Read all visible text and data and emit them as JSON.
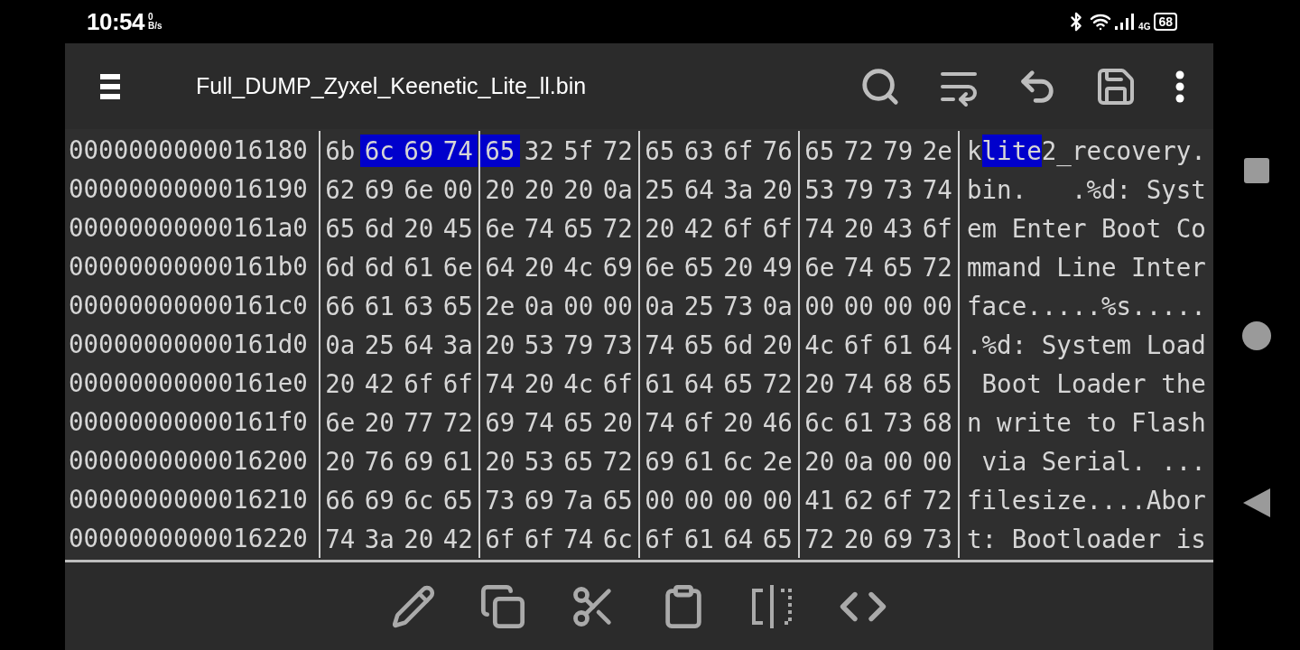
{
  "status_bar": {
    "time": "10:54",
    "net_speed_value": "0",
    "net_speed_unit": "B/s",
    "network_type": "4G",
    "battery": "68"
  },
  "toolbar": {
    "title": "Full_DUMP_Zyxel_Keenetic_Lite_ll.bin"
  },
  "hex_rows": [
    {
      "address": "0000000000016180",
      "bytes": [
        {
          "hex": "6b",
          "selected": false
        },
        {
          "hex": "6c",
          "selected": true
        },
        {
          "hex": "69",
          "selected": true
        },
        {
          "hex": "74",
          "selected": true
        },
        {
          "hex": "65",
          "selected": true
        },
        {
          "hex": "32",
          "selected": false
        },
        {
          "hex": "5f",
          "selected": false
        },
        {
          "hex": "72",
          "selected": false
        },
        {
          "hex": "65",
          "selected": false
        },
        {
          "hex": "63",
          "selected": false
        },
        {
          "hex": "6f",
          "selected": false
        },
        {
          "hex": "76",
          "selected": false
        },
        {
          "hex": "65",
          "selected": false
        },
        {
          "hex": "72",
          "selected": false
        },
        {
          "hex": "79",
          "selected": false
        },
        {
          "hex": "2e",
          "selected": false
        }
      ],
      "ascii": [
        {
          "text": "k",
          "selected": false
        },
        {
          "text": "lite",
          "selected": true
        },
        {
          "text": "2_recovery.",
          "selected": false
        }
      ]
    },
    {
      "address": "0000000000016190",
      "bytes": [
        {
          "hex": "62",
          "selected": false
        },
        {
          "hex": "69",
          "selected": false
        },
        {
          "hex": "6e",
          "selected": false
        },
        {
          "hex": "00",
          "selected": false
        },
        {
          "hex": "20",
          "selected": false
        },
        {
          "hex": "20",
          "selected": false
        },
        {
          "hex": "20",
          "selected": false
        },
        {
          "hex": "0a",
          "selected": false
        },
        {
          "hex": "25",
          "selected": false
        },
        {
          "hex": "64",
          "selected": false
        },
        {
          "hex": "3a",
          "selected": false
        },
        {
          "hex": "20",
          "selected": false
        },
        {
          "hex": "53",
          "selected": false
        },
        {
          "hex": "79",
          "selected": false
        },
        {
          "hex": "73",
          "selected": false
        },
        {
          "hex": "74",
          "selected": false
        }
      ],
      "ascii": [
        {
          "text": "bin.   .%d: Syst",
          "selected": false
        }
      ]
    },
    {
      "address": "00000000000161a0",
      "bytes": [
        {
          "hex": "65",
          "selected": false
        },
        {
          "hex": "6d",
          "selected": false
        },
        {
          "hex": "20",
          "selected": false
        },
        {
          "hex": "45",
          "selected": false
        },
        {
          "hex": "6e",
          "selected": false
        },
        {
          "hex": "74",
          "selected": false
        },
        {
          "hex": "65",
          "selected": false
        },
        {
          "hex": "72",
          "selected": false
        },
        {
          "hex": "20",
          "selected": false
        },
        {
          "hex": "42",
          "selected": false
        },
        {
          "hex": "6f",
          "selected": false
        },
        {
          "hex": "6f",
          "selected": false
        },
        {
          "hex": "74",
          "selected": false
        },
        {
          "hex": "20",
          "selected": false
        },
        {
          "hex": "43",
          "selected": false
        },
        {
          "hex": "6f",
          "selected": false
        }
      ],
      "ascii": [
        {
          "text": "em Enter Boot Co",
          "selected": false
        }
      ]
    },
    {
      "address": "00000000000161b0",
      "bytes": [
        {
          "hex": "6d",
          "selected": false
        },
        {
          "hex": "6d",
          "selected": false
        },
        {
          "hex": "61",
          "selected": false
        },
        {
          "hex": "6e",
          "selected": false
        },
        {
          "hex": "64",
          "selected": false
        },
        {
          "hex": "20",
          "selected": false
        },
        {
          "hex": "4c",
          "selected": false
        },
        {
          "hex": "69",
          "selected": false
        },
        {
          "hex": "6e",
          "selected": false
        },
        {
          "hex": "65",
          "selected": false
        },
        {
          "hex": "20",
          "selected": false
        },
        {
          "hex": "49",
          "selected": false
        },
        {
          "hex": "6e",
          "selected": false
        },
        {
          "hex": "74",
          "selected": false
        },
        {
          "hex": "65",
          "selected": false
        },
        {
          "hex": "72",
          "selected": false
        }
      ],
      "ascii": [
        {
          "text": "mmand Line Inter",
          "selected": false
        }
      ]
    },
    {
      "address": "00000000000161c0",
      "bytes": [
        {
          "hex": "66",
          "selected": false
        },
        {
          "hex": "61",
          "selected": false
        },
        {
          "hex": "63",
          "selected": false
        },
        {
          "hex": "65",
          "selected": false
        },
        {
          "hex": "2e",
          "selected": false
        },
        {
          "hex": "0a",
          "selected": false
        },
        {
          "hex": "00",
          "selected": false
        },
        {
          "hex": "00",
          "selected": false
        },
        {
          "hex": "0a",
          "selected": false
        },
        {
          "hex": "25",
          "selected": false
        },
        {
          "hex": "73",
          "selected": false
        },
        {
          "hex": "0a",
          "selected": false
        },
        {
          "hex": "00",
          "selected": false
        },
        {
          "hex": "00",
          "selected": false
        },
        {
          "hex": "00",
          "selected": false
        },
        {
          "hex": "00",
          "selected": false
        }
      ],
      "ascii": [
        {
          "text": "face.....%s.....",
          "selected": false
        }
      ]
    },
    {
      "address": "00000000000161d0",
      "bytes": [
        {
          "hex": "0a",
          "selected": false
        },
        {
          "hex": "25",
          "selected": false
        },
        {
          "hex": "64",
          "selected": false
        },
        {
          "hex": "3a",
          "selected": false
        },
        {
          "hex": "20",
          "selected": false
        },
        {
          "hex": "53",
          "selected": false
        },
        {
          "hex": "79",
          "selected": false
        },
        {
          "hex": "73",
          "selected": false
        },
        {
          "hex": "74",
          "selected": false
        },
        {
          "hex": "65",
          "selected": false
        },
        {
          "hex": "6d",
          "selected": false
        },
        {
          "hex": "20",
          "selected": false
        },
        {
          "hex": "4c",
          "selected": false
        },
        {
          "hex": "6f",
          "selected": false
        },
        {
          "hex": "61",
          "selected": false
        },
        {
          "hex": "64",
          "selected": false
        }
      ],
      "ascii": [
        {
          "text": ".%d: System Load",
          "selected": false
        }
      ]
    },
    {
      "address": "00000000000161e0",
      "bytes": [
        {
          "hex": "20",
          "selected": false
        },
        {
          "hex": "42",
          "selected": false
        },
        {
          "hex": "6f",
          "selected": false
        },
        {
          "hex": "6f",
          "selected": false
        },
        {
          "hex": "74",
          "selected": false
        },
        {
          "hex": "20",
          "selected": false
        },
        {
          "hex": "4c",
          "selected": false
        },
        {
          "hex": "6f",
          "selected": false
        },
        {
          "hex": "61",
          "selected": false
        },
        {
          "hex": "64",
          "selected": false
        },
        {
          "hex": "65",
          "selected": false
        },
        {
          "hex": "72",
          "selected": false
        },
        {
          "hex": "20",
          "selected": false
        },
        {
          "hex": "74",
          "selected": false
        },
        {
          "hex": "68",
          "selected": false
        },
        {
          "hex": "65",
          "selected": false
        }
      ],
      "ascii": [
        {
          "text": " Boot Loader the",
          "selected": false
        }
      ]
    },
    {
      "address": "00000000000161f0",
      "bytes": [
        {
          "hex": "6e",
          "selected": false
        },
        {
          "hex": "20",
          "selected": false
        },
        {
          "hex": "77",
          "selected": false
        },
        {
          "hex": "72",
          "selected": false
        },
        {
          "hex": "69",
          "selected": false
        },
        {
          "hex": "74",
          "selected": false
        },
        {
          "hex": "65",
          "selected": false
        },
        {
          "hex": "20",
          "selected": false
        },
        {
          "hex": "74",
          "selected": false
        },
        {
          "hex": "6f",
          "selected": false
        },
        {
          "hex": "20",
          "selected": false
        },
        {
          "hex": "46",
          "selected": false
        },
        {
          "hex": "6c",
          "selected": false
        },
        {
          "hex": "61",
          "selected": false
        },
        {
          "hex": "73",
          "selected": false
        },
        {
          "hex": "68",
          "selected": false
        }
      ],
      "ascii": [
        {
          "text": "n write to Flash",
          "selected": false
        }
      ]
    },
    {
      "address": "0000000000016200",
      "bytes": [
        {
          "hex": "20",
          "selected": false
        },
        {
          "hex": "76",
          "selected": false
        },
        {
          "hex": "69",
          "selected": false
        },
        {
          "hex": "61",
          "selected": false
        },
        {
          "hex": "20",
          "selected": false
        },
        {
          "hex": "53",
          "selected": false
        },
        {
          "hex": "65",
          "selected": false
        },
        {
          "hex": "72",
          "selected": false
        },
        {
          "hex": "69",
          "selected": false
        },
        {
          "hex": "61",
          "selected": false
        },
        {
          "hex": "6c",
          "selected": false
        },
        {
          "hex": "2e",
          "selected": false
        },
        {
          "hex": "20",
          "selected": false
        },
        {
          "hex": "0a",
          "selected": false
        },
        {
          "hex": "00",
          "selected": false
        },
        {
          "hex": "00",
          "selected": false
        }
      ],
      "ascii": [
        {
          "text": " via Serial. ...",
          "selected": false
        }
      ]
    },
    {
      "address": "0000000000016210",
      "bytes": [
        {
          "hex": "66",
          "selected": false
        },
        {
          "hex": "69",
          "selected": false
        },
        {
          "hex": "6c",
          "selected": false
        },
        {
          "hex": "65",
          "selected": false
        },
        {
          "hex": "73",
          "selected": false
        },
        {
          "hex": "69",
          "selected": false
        },
        {
          "hex": "7a",
          "selected": false
        },
        {
          "hex": "65",
          "selected": false
        },
        {
          "hex": "00",
          "selected": false
        },
        {
          "hex": "00",
          "selected": false
        },
        {
          "hex": "00",
          "selected": false
        },
        {
          "hex": "00",
          "selected": false
        },
        {
          "hex": "41",
          "selected": false
        },
        {
          "hex": "62",
          "selected": false
        },
        {
          "hex": "6f",
          "selected": false
        },
        {
          "hex": "72",
          "selected": false
        }
      ],
      "ascii": [
        {
          "text": "filesize....Abor",
          "selected": false
        }
      ]
    },
    {
      "address": "0000000000016220",
      "bytes": [
        {
          "hex": "74",
          "selected": false
        },
        {
          "hex": "3a",
          "selected": false
        },
        {
          "hex": "20",
          "selected": false
        },
        {
          "hex": "42",
          "selected": false
        },
        {
          "hex": "6f",
          "selected": false
        },
        {
          "hex": "6f",
          "selected": false
        },
        {
          "hex": "74",
          "selected": false
        },
        {
          "hex": "6c",
          "selected": false
        },
        {
          "hex": "6f",
          "selected": false
        },
        {
          "hex": "61",
          "selected": false
        },
        {
          "hex": "64",
          "selected": false
        },
        {
          "hex": "65",
          "selected": false
        },
        {
          "hex": "72",
          "selected": false
        },
        {
          "hex": "20",
          "selected": false
        },
        {
          "hex": "69",
          "selected": false
        },
        {
          "hex": "73",
          "selected": false
        }
      ],
      "ascii": [
        {
          "text": "t: Bootloader is",
          "selected": false
        }
      ]
    }
  ]
}
